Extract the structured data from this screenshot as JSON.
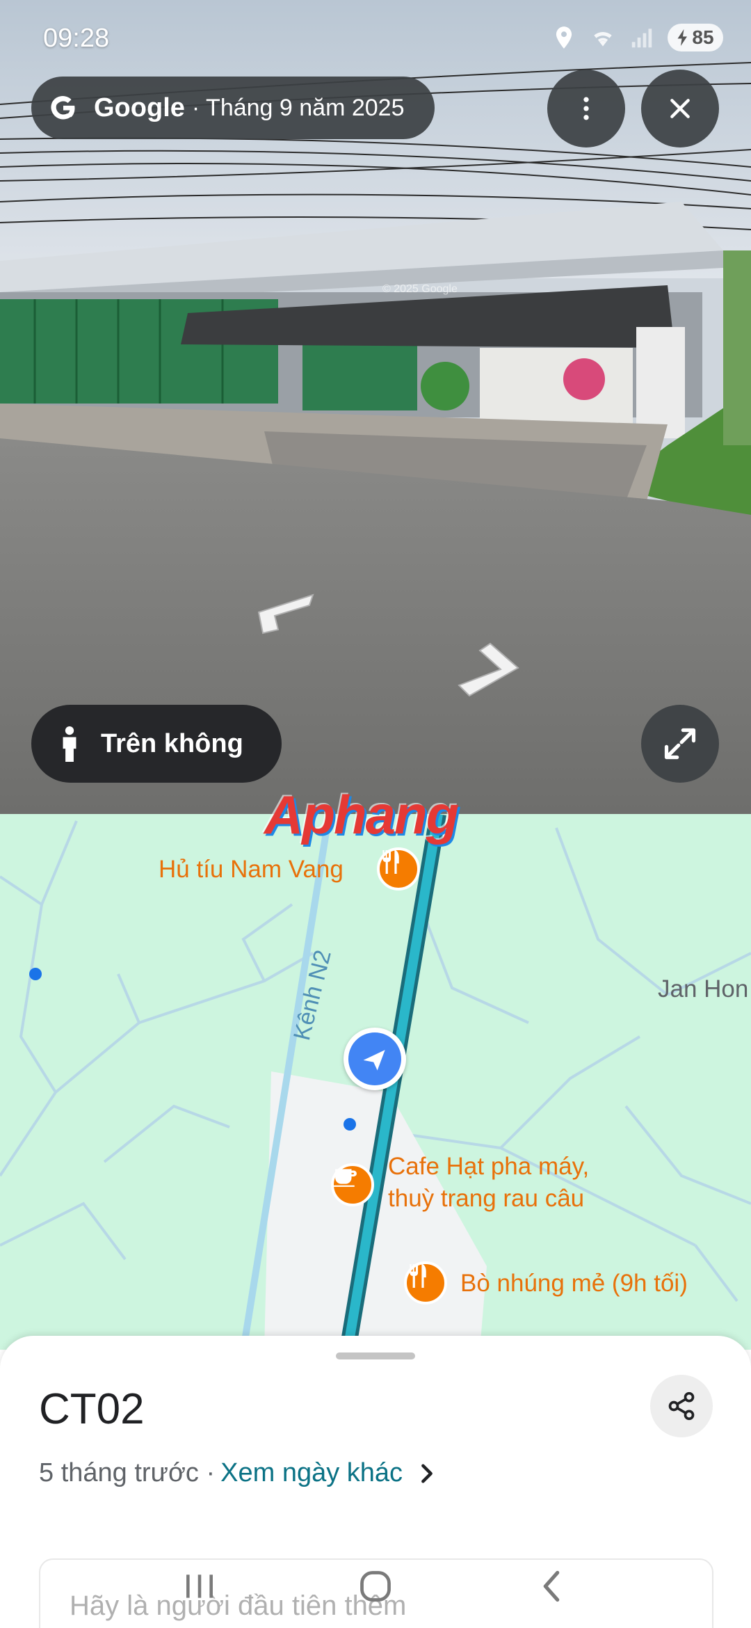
{
  "status_bar": {
    "time": "09:28",
    "battery": "85",
    "icons": [
      "location-icon",
      "wifi-icon",
      "signal-icon",
      "battery-charging-icon"
    ]
  },
  "street_view": {
    "brand": "Google",
    "capture_date": "· Tháng 9 năm 2025",
    "aerial_button": "Trên không",
    "image_watermark": "© 2025 Google",
    "icons": [
      "google-g-icon",
      "more-vert-icon",
      "close-icon",
      "expand-icon",
      "pegman-icon",
      "nav-left-arrow",
      "nav-right-arrow"
    ]
  },
  "map": {
    "watermark": "Aphang",
    "pois": [
      {
        "name": "Hủ tíu Nam Vang",
        "icon": "restaurant-icon"
      },
      {
        "name_line1": "Cafe Hạt pha máy,",
        "name_line2": "thuỳ trang rau câu",
        "icon": "cafe-icon"
      },
      {
        "name": "Bò nhúng mẻ (9h tối)",
        "icon": "restaurant-icon"
      }
    ],
    "road_label": "Kênh N2",
    "area_label": "Jan Hon",
    "colors": {
      "background": "#cdf5df",
      "road": "#2ab7ca",
      "poi": "#f57c00"
    }
  },
  "sheet": {
    "title": "CT02",
    "age": "5 tháng trước ·",
    "other_dates_link": "Xem ngày khác",
    "faded_prompt": "Hãy là người đầu tiên thêm"
  }
}
